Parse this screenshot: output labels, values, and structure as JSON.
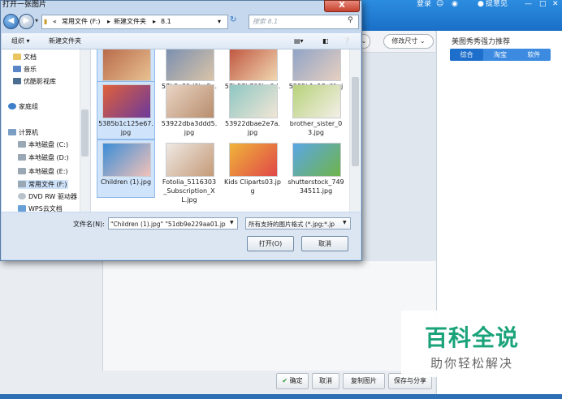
{
  "app": {
    "topbar": {
      "login": "登录",
      "feedback": "提意见"
    },
    "toolbar": {
      "resize_label": "修改尺寸"
    },
    "right_panel": {
      "title": "美图秀秀强力推荐",
      "tabs": [
        "综合",
        "淘宝",
        "软件"
      ]
    },
    "bottom_buttons": {
      "confirm": "确定",
      "cancel": "取消",
      "copy": "复制图片",
      "save_share": "保存与分享"
    }
  },
  "watermark": {
    "title": "百科全说",
    "subtitle": "助你轻松解决"
  },
  "dialog": {
    "title": "打开一张图片",
    "close_symbol": "X",
    "breadcrumb": [
      "常用文件 (F:)",
      "新建文件夹",
      "8.1"
    ],
    "search_placeholder": "搜索 8.1",
    "cmd": {
      "organize": "组织 ▾",
      "new_folder": "新建文件夹"
    },
    "nav_items": [
      {
        "label": "文档",
        "icon": "documents-icon"
      },
      {
        "label": "音乐",
        "icon": "music-icon"
      },
      {
        "label": "优酷影视库",
        "icon": "video-library-icon"
      },
      {
        "label": "家庭组",
        "icon": "homegroup-icon"
      },
      {
        "label": "计算机",
        "icon": "computer-icon"
      },
      {
        "label": "本地磁盘 (C:)",
        "icon": "drive-icon"
      },
      {
        "label": "本地磁盘 (D:)",
        "icon": "drive-icon"
      },
      {
        "label": "本地磁盘 (E:)",
        "icon": "drive-icon"
      },
      {
        "label": "常用文件 (F:)",
        "icon": "drive-icon"
      },
      {
        "label": "DVD RW 驱动器",
        "icon": "dvd-icon"
      },
      {
        "label": "WPS云文档",
        "icon": "cloud-icon"
      }
    ],
    "files": [
      {
        "name": "51db9e229aa01.jpg",
        "selected": true,
        "colors": [
          "#b86a4a",
          "#e8c090"
        ]
      },
      {
        "name": "57b3e21d9be5a.jpg",
        "selected": false,
        "colors": [
          "#7a8fb0",
          "#d9c4a8"
        ]
      },
      {
        "name": "57b57b709be0d.jpg",
        "selected": false,
        "colors": [
          "#c05640",
          "#f0d7b0"
        ]
      },
      {
        "name": "5385b1c18c6fc.jpg",
        "selected": false,
        "colors": [
          "#8fa3c7",
          "#e6cfc0"
        ]
      },
      {
        "name": "5385b1c125e67.jpg",
        "selected": true,
        "colors": [
          "#e0603a",
          "#6b3a9c"
        ]
      },
      {
        "name": "53922dba3ddd5.jpg",
        "selected": false,
        "colors": [
          "#e9d5c4",
          "#b88d6d"
        ]
      },
      {
        "name": "53922dbae2e7a.jpg",
        "selected": false,
        "colors": [
          "#8ec7c2",
          "#f1e6d6"
        ]
      },
      {
        "name": "brother_sister_03.jpg",
        "selected": false,
        "colors": [
          "#b7d27a",
          "#f4efe8"
        ]
      },
      {
        "name": "Children (1).jpg",
        "selected": true,
        "colors": [
          "#3b8ed8",
          "#f2c1b8"
        ]
      },
      {
        "name": "Fotolia_5116303_Subscription_XL.jpg",
        "selected": false,
        "colors": [
          "#efe9e3",
          "#c49a78"
        ]
      },
      {
        "name": "Kids Cliparts03.jpg",
        "selected": false,
        "colors": [
          "#f0b43a",
          "#e04848"
        ]
      },
      {
        "name": "shutterstock_74934511.jpg",
        "selected": false,
        "colors": [
          "#5ba6e6",
          "#6fb44a"
        ]
      }
    ],
    "filename_label": "文件名(N):",
    "filename_value": "\"Children (1).jpg\" \"51db9e229aa01.jp",
    "filetype_value": "所有支持的图片格式 (*.jpg;*.jp",
    "open_label": "打开(O)",
    "cancel_label": "取消"
  }
}
